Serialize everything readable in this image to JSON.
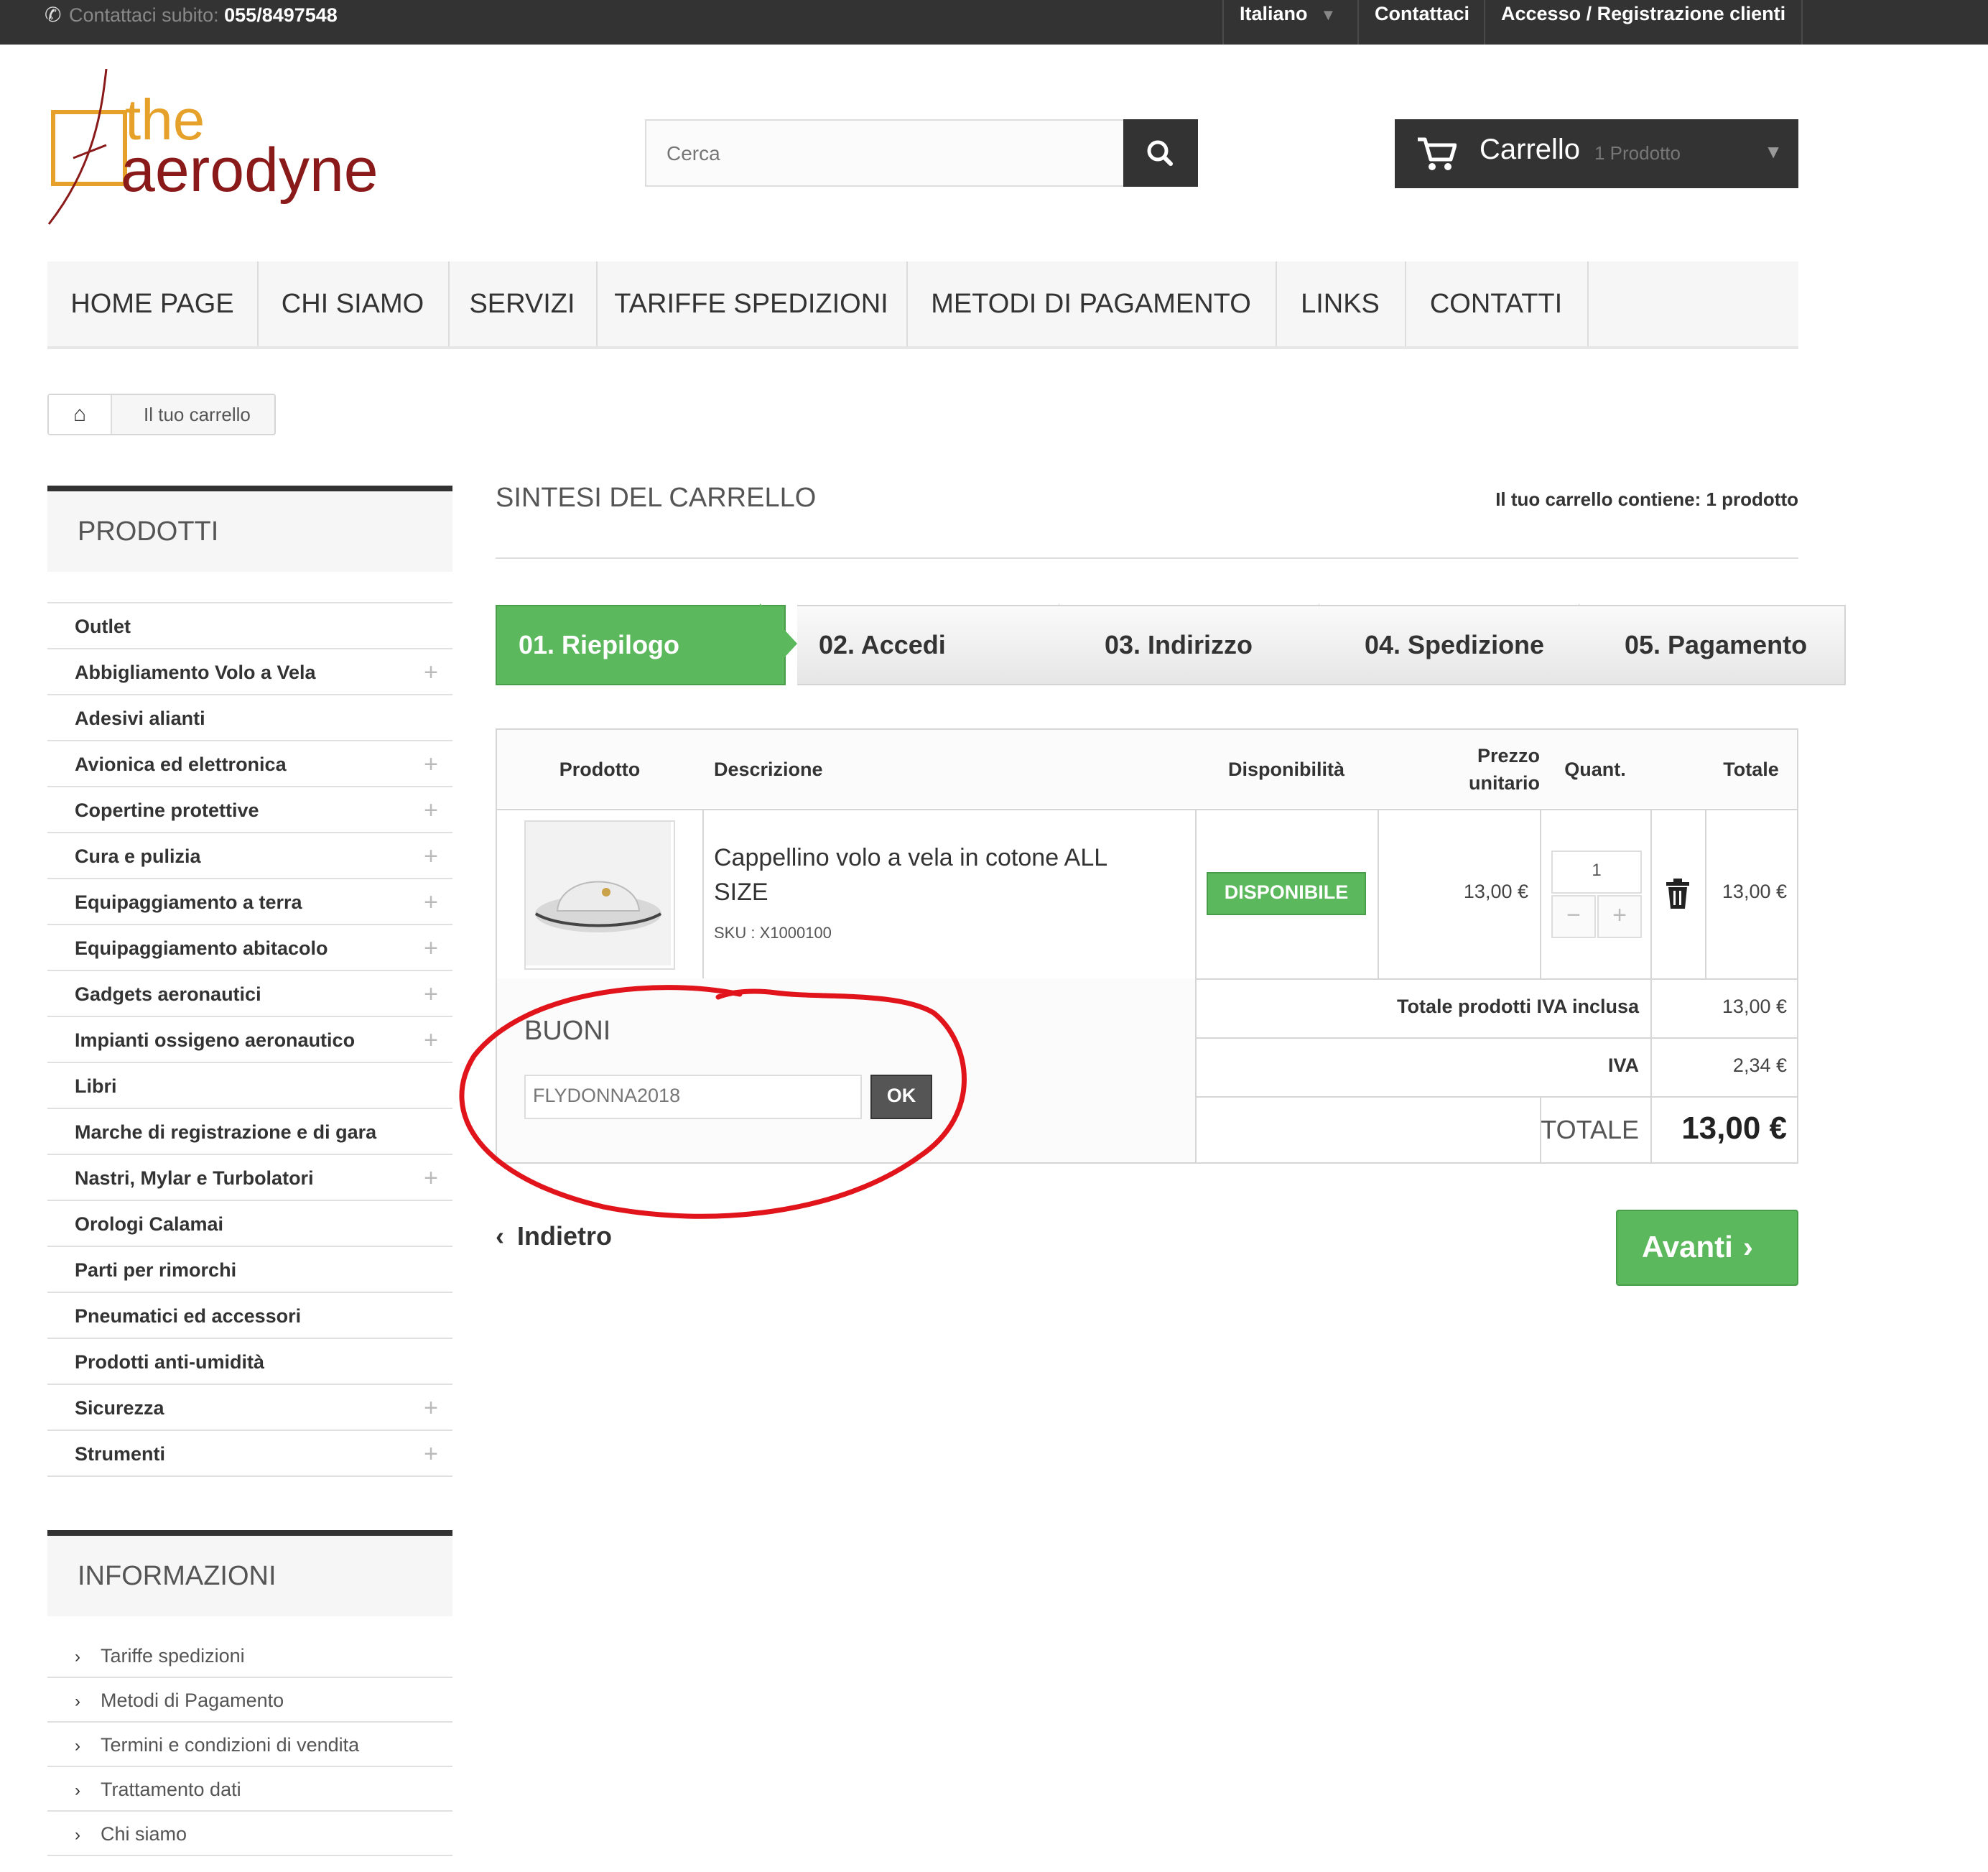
{
  "topbar": {
    "phone_label": "Contattaci subito:",
    "phone_number": "055/8497548",
    "language": "Italiano",
    "contact": "Contattaci",
    "login": "Accesso / Registrazione clienti"
  },
  "logo": {
    "line1": "the",
    "line2": "aerodyne"
  },
  "search": {
    "placeholder": "Cerca"
  },
  "cart": {
    "label": "Carrello",
    "count": "1 Prodotto"
  },
  "nav": [
    "HOME PAGE",
    "CHI SIAMO",
    "SERVIZI",
    "TARIFFE SPEDIZIONI",
    "METODI DI PAGAMENTO",
    "LINKS",
    "CONTATTI"
  ],
  "breadcrumb": {
    "current": "Il tuo carrello"
  },
  "sidebar": {
    "products_title": "PRODOTTI",
    "categories": [
      "Outlet",
      "Abbigliamento Volo a Vela",
      "Adesivi alianti",
      "Avionica ed elettronica",
      "Copertine protettive",
      "Cura e pulizia",
      "Equipaggiamento a terra",
      "Equipaggiamento abitacolo",
      "Gadgets aeronautici",
      "Impianti ossigeno aeronautico",
      "Libri",
      "Marche di registrazione e di gara",
      "Nastri, Mylar e Turbolatori",
      "Orologi Calamai",
      "Parti per rimorchi",
      "Pneumatici ed accessori",
      "Prodotti anti-umidità",
      "Sicurezza",
      "Strumenti"
    ],
    "info_title": "INFORMAZIONI",
    "info_links": [
      "Tariffe spedizioni",
      "Metodi di Pagamento",
      "Termini e condizioni di vendita",
      "Trattamento dati",
      "Chi siamo"
    ]
  },
  "main": {
    "title": "SINTESI DEL CARRELLO",
    "cart_summary": "Il tuo carrello contiene: 1 prodotto",
    "steps": [
      "01. Riepilogo",
      "02. Accedi",
      "03. Indirizzo",
      "04. Spedizione",
      "05. Pagamento"
    ],
    "table": {
      "headers": {
        "product": "Prodotto",
        "description": "Descrizione",
        "availability": "Disponibilità",
        "unit_price_1": "Prezzo",
        "unit_price_2": "unitario",
        "qty": "Quant.",
        "total": "Totale"
      },
      "item": {
        "name_line1": "Cappellino volo a vela in cotone ALL",
        "name_line2": "SIZE",
        "sku": "SKU : X1000100",
        "availability": "DISPONIBILE",
        "unit_price": "13,00 €",
        "qty": "1",
        "total": "13,00 €"
      },
      "totals": {
        "products_label": "Totale prodotti IVA inclusa",
        "products_value": "13,00 €",
        "vat_label": "IVA",
        "vat_value": "2,34 €",
        "total_label": "TOTALE",
        "total_value": "13,00 €"
      }
    },
    "voucher": {
      "title": "BUONI",
      "code": "FLYDONNA2018",
      "ok": "OK"
    },
    "back": "Indietro",
    "next": "Avanti"
  },
  "colors": {
    "accent_green": "#5cb85c",
    "dark": "#333333",
    "annotation_red": "#e0141a"
  }
}
